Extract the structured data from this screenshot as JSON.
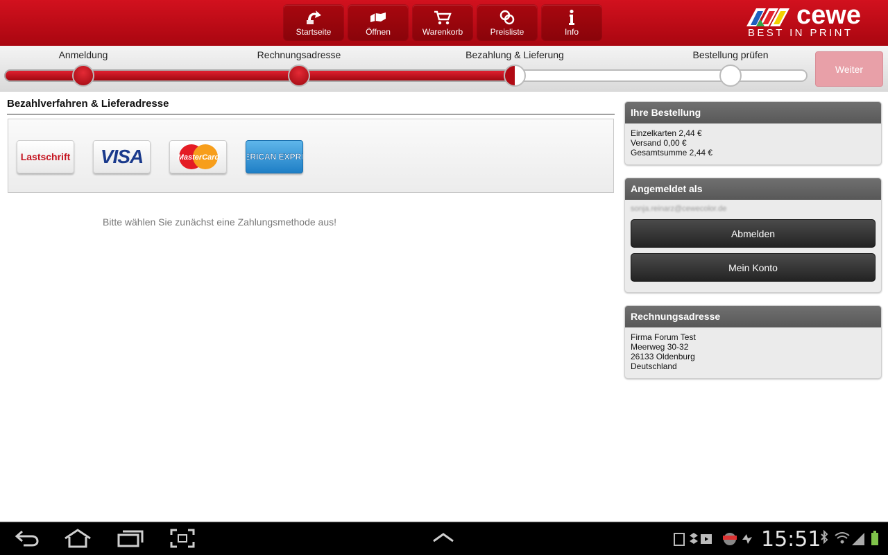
{
  "header": {
    "nav": [
      {
        "label": "Startseite",
        "icon": "home-arrow-icon"
      },
      {
        "label": "Öffnen",
        "icon": "open-hand-icon"
      },
      {
        "label": "Warenkorb",
        "icon": "cart-icon"
      },
      {
        "label": "Preisliste",
        "icon": "coins-icon"
      },
      {
        "label": "Info",
        "icon": "info-icon"
      }
    ],
    "logo": {
      "word": "cewe",
      "tagline": "BEST IN PRINT"
    }
  },
  "progress": {
    "steps": [
      "Anmeldung",
      "Rechnungsadresse",
      "Bezahlung & Lieferung",
      "Bestellung prüfen"
    ],
    "current_step": 3,
    "next_button": "Weiter"
  },
  "main": {
    "title": "Bezahlverfahren & Lieferadresse",
    "payment_methods": [
      "Lastschrift",
      "VISA",
      "MasterCard",
      "AMERICAN EXPRESS"
    ],
    "hint": "Bitte wählen Sie zunächst eine Zahlungsmethode aus!"
  },
  "sidebar": {
    "order": {
      "title": "Ihre Bestellung",
      "lines": [
        "Einzelkarten 2,44 €",
        "Versand 0,00 €",
        "Gesamtsumme 2,44 €"
      ]
    },
    "account": {
      "title": "Angemeldet als",
      "email": "sonja.reinarz@cewecolor.de",
      "logout_button": "Abmelden",
      "account_button": "Mein Konto"
    },
    "billing": {
      "title": "Rechnungsadresse",
      "lines": [
        "Firma Forum Test",
        "Meerweg 30-32",
        "26133 Oldenburg",
        "Deutschland"
      ]
    }
  },
  "system_bar": {
    "time": "15:51"
  }
}
